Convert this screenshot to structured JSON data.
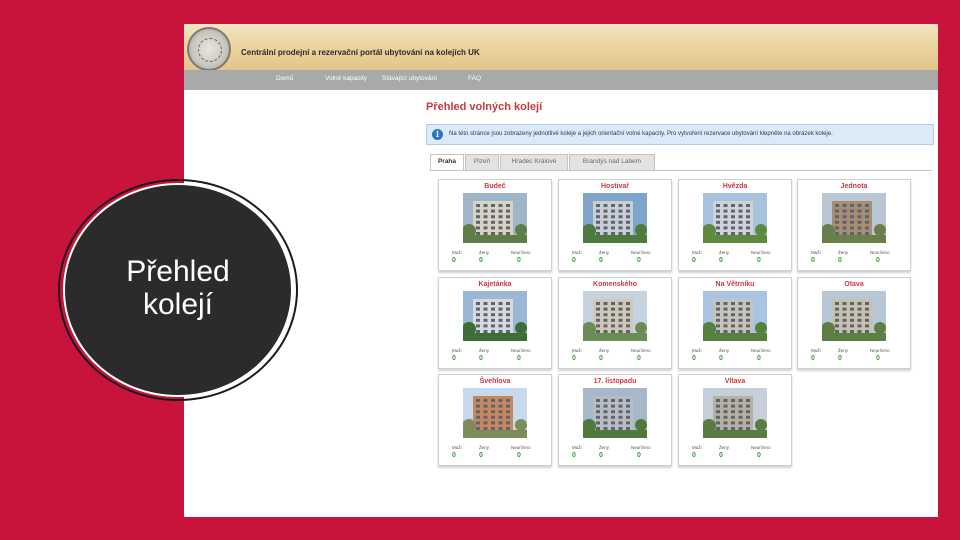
{
  "portal": {
    "title": "Centrální prodejní a rezervační portál ubytování na kolejích UK"
  },
  "nav": {
    "items": [
      "Domů",
      "Volné kapacity",
      "Stávající ubytování",
      "FAQ"
    ]
  },
  "page": {
    "title": "Přehled volných kolejí",
    "info": "Na této stránce jsou zobrazeny jednotlivé koleje a jejich orientační volné kapacity. Pro vytvoření rezervace ubytování klepněte na obrázek koleje."
  },
  "tabs": [
    "Praha",
    "Plzeň",
    "Hradec Králové",
    "Brandýs nad Labem"
  ],
  "stat_labels": {
    "men": "Muži",
    "women": "Ženy",
    "unspecified": "Neurčeno"
  },
  "dorms": [
    {
      "name": "Budeč",
      "men": "0",
      "women": "0",
      "unspecified": "0"
    },
    {
      "name": "Hostivař",
      "men": "0",
      "women": "0",
      "unspecified": "0"
    },
    {
      "name": "Hvězda",
      "men": "0",
      "women": "0",
      "unspecified": "0"
    },
    {
      "name": "Jednota",
      "men": "0",
      "women": "0",
      "unspecified": "0"
    },
    {
      "name": "Kajetánka",
      "men": "0",
      "women": "0",
      "unspecified": "0"
    },
    {
      "name": "Komenského",
      "men": "0",
      "women": "0",
      "unspecified": "0"
    },
    {
      "name": "Na Větrníku",
      "men": "0",
      "women": "0",
      "unspecified": "0"
    },
    {
      "name": "Otava",
      "men": "0",
      "women": "0",
      "unspecified": "0"
    },
    {
      "name": "Švehlova",
      "men": "0",
      "women": "0",
      "unspecified": "0"
    },
    {
      "name": "17. listopadu",
      "men": "0",
      "women": "0",
      "unspecified": "0"
    },
    {
      "name": "Vltava",
      "men": "0",
      "women": "0",
      "unspecified": "0"
    }
  ],
  "overlay": {
    "line1": "Přehled",
    "line2": "kolejí"
  },
  "colors": {
    "background": "#c8133c",
    "accent_red": "#c8393f",
    "value_green": "#3a9b3a",
    "nav_grey": "#a9a9a9"
  }
}
